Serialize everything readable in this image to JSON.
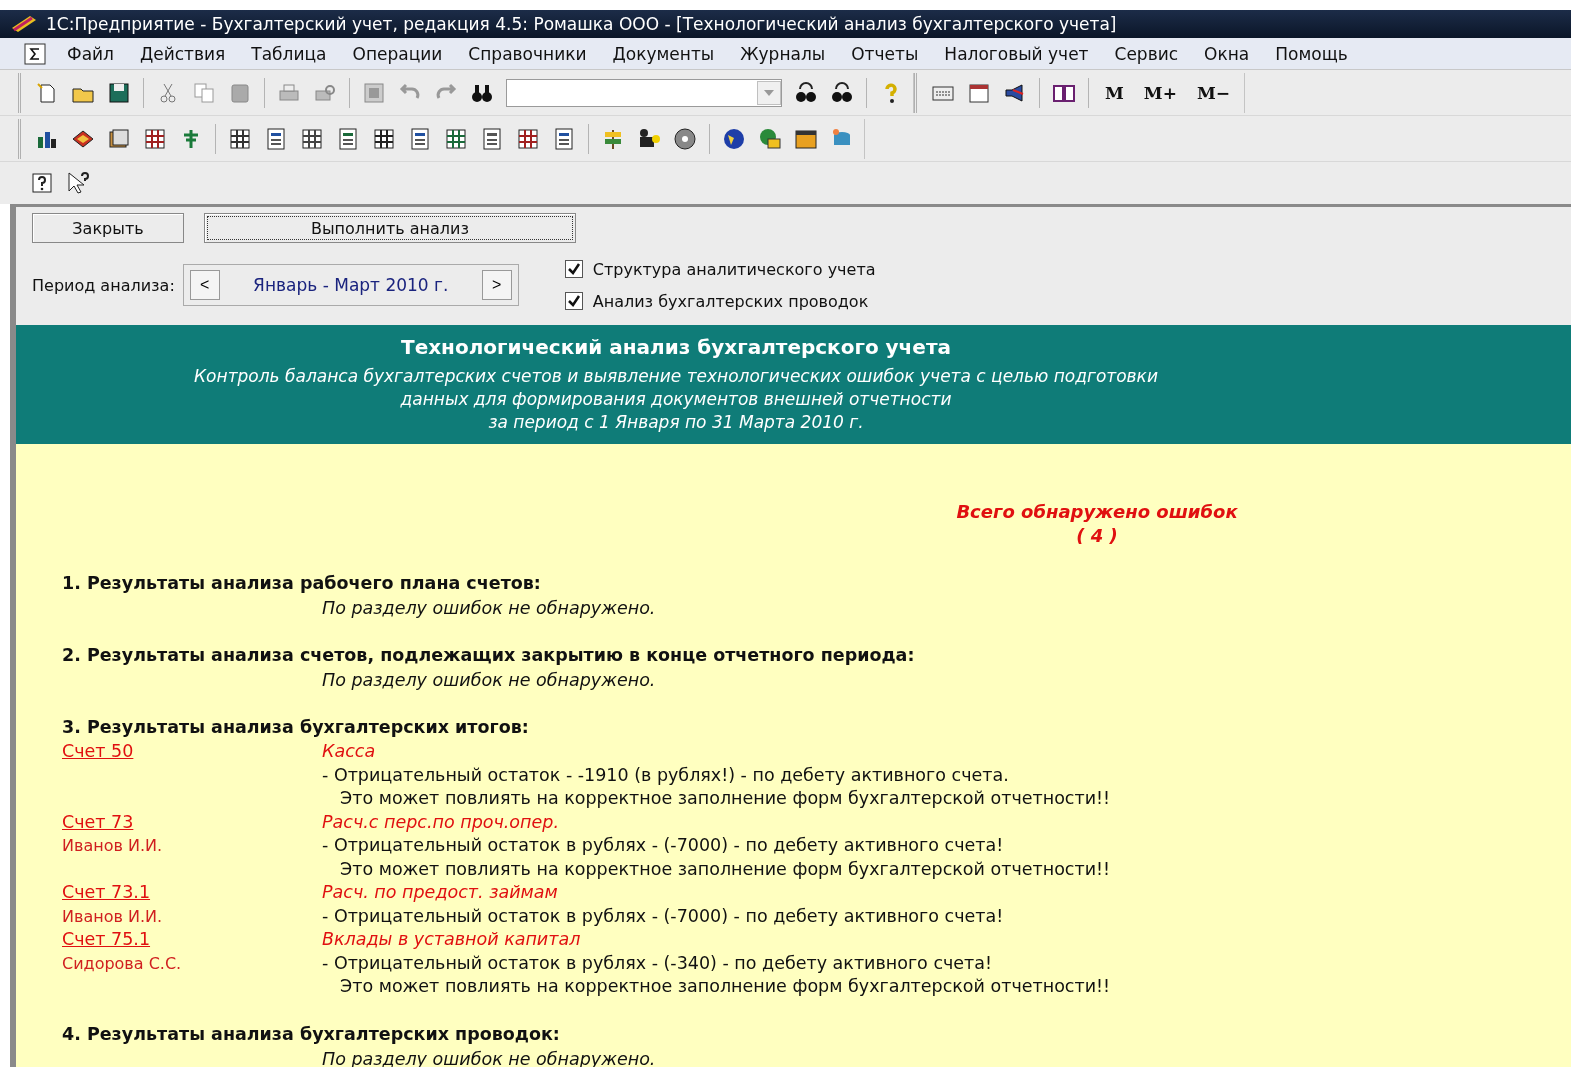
{
  "window": {
    "title": "1С:Предприятие - Бухгалтерский учет, редакция 4.5: Ромашка ООО - [Технологический анализ бухгалтерского учета]"
  },
  "menu": [
    "Файл",
    "Действия",
    "Таблица",
    "Операции",
    "Справочники",
    "Документы",
    "Журналы",
    "Отчеты",
    "Налоговый учет",
    "Сервис",
    "Окна",
    "Помощь"
  ],
  "memory_buttons": [
    "M",
    "M+",
    "M−"
  ],
  "form": {
    "close_button": "Закрыть",
    "run_button": "Выполнить анализ",
    "period_label": "Период анализа:",
    "prev": "<",
    "period": "Январь - Март 2010 г.",
    "next": ">",
    "checkboxes": [
      {
        "label": "Структура аналитического учета",
        "checked": true
      },
      {
        "label": "Анализ бухгалтерских проводок",
        "checked": true
      }
    ]
  },
  "report": {
    "title": "Технологический анализ бухгалтерского учета",
    "subtitle": [
      "Контроль баланса бухгалтерских счетов и выявление технологических ошибок учета с целью подготовки",
      "данных для формирования документов внешней отчетности",
      "за  период с 1 Января по 31 Марта 2010 г."
    ],
    "total_label": "Всего обнаружено ошибок",
    "total_count": "( 4 )",
    "sections": [
      {
        "heading": "1. Результаты анализа рабочего плана счетов:",
        "note": "По разделу ошибок не обнаружено."
      },
      {
        "heading": "2. Результаты анализа счетов, подлежащих закрытию в конце отчетного периода:",
        "note": "По разделу ошибок не обнаружено."
      },
      {
        "heading": "3. Результаты анализа бухгалтерских итогов:",
        "entries": [
          {
            "account": "Счет 50",
            "name": "Касса",
            "message": "-  Отрицательный остаток -  -1910 (в рублях!) - по дебету активного счета.",
            "warning": "Это может повлиять на корректное заполнение форм бухгалтерской отчетности!!"
          },
          {
            "account": "Счет 73",
            "name": "Расч.с перс.по проч.опер.",
            "person": "Иванов И.И.",
            "message": "-  Отрицательный остаток в рублях - (-7000) - по дебету активного счета!",
            "warning": "Это может повлиять на корректное заполнение форм бухгалтерской отчетности!!"
          },
          {
            "account": "Счет 73.1",
            "name": "Расч. по предост. займам",
            "person": "Иванов И.И.",
            "message": "-  Отрицательный остаток в рублях - (-7000) - по дебету активного счета!"
          },
          {
            "account": "Счет 75.1",
            "name": "Вклады в уставной капитал",
            "person": "Сидорова С.С.",
            "message": "-  Отрицательный остаток в рублях - (-340) - по дебету активного счета!",
            "warning": "Это может повлиять на корректное заполнение форм бухгалтерской отчетности!!"
          }
        ]
      },
      {
        "heading": "4. Результаты анализа бухгалтерских проводок:",
        "note": "По разделу ошибок не обнаружено."
      }
    ]
  }
}
